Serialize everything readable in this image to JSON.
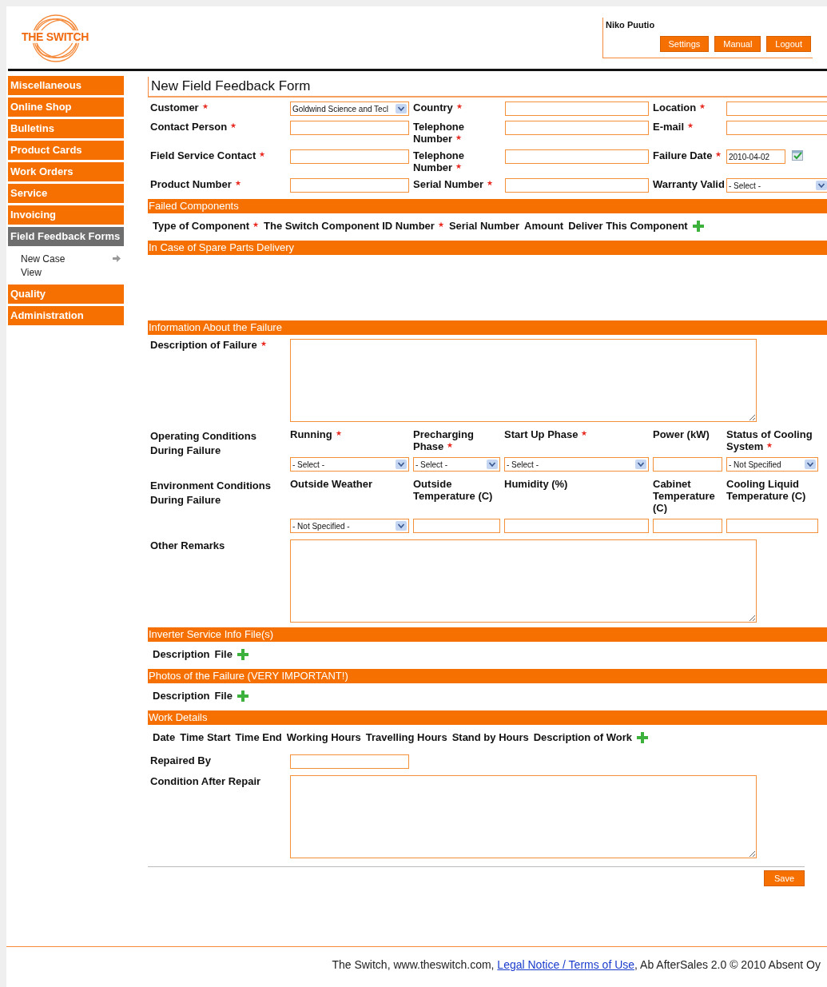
{
  "header": {
    "logo_text": "THE SWITCH",
    "user": "Niko Puutio",
    "buttons": [
      "Settings",
      "Manual",
      "Logout"
    ]
  },
  "sidebar": {
    "items": [
      {
        "label": "Miscellaneous",
        "selected": false
      },
      {
        "label": "Online Shop",
        "selected": false
      },
      {
        "label": "Bulletins",
        "selected": false
      },
      {
        "label": "Product Cards",
        "selected": false
      },
      {
        "label": "Work Orders",
        "selected": false
      },
      {
        "label": "Service",
        "selected": false
      },
      {
        "label": "Invoicing",
        "selected": false
      },
      {
        "label": "Field Feedback Forms",
        "selected": true,
        "children": [
          {
            "label": "New Case",
            "current": true
          },
          {
            "label": "View",
            "current": false
          }
        ]
      },
      {
        "label": "Quality",
        "selected": false
      },
      {
        "label": "Administration",
        "selected": false
      }
    ]
  },
  "form": {
    "title": "New Field Feedback Form",
    "rows": [
      [
        {
          "label": "Customer",
          "required": true,
          "kind": "select",
          "value": "Goldwind Science and Tecl"
        },
        {
          "label": "Country",
          "required": true,
          "kind": "text"
        },
        {
          "label": "Location",
          "required": true,
          "kind": "text"
        }
      ],
      [
        {
          "label": "Contact Person",
          "required": true,
          "kind": "text"
        },
        {
          "label": "Telephone Number",
          "required": true,
          "kind": "text"
        },
        {
          "label": "E-mail",
          "required": true,
          "kind": "text"
        }
      ],
      [
        {
          "label": "Field Service Contact",
          "required": true,
          "kind": "text"
        },
        {
          "label": "Telephone Number",
          "required": true,
          "kind": "text"
        },
        {
          "label": "Failure Date",
          "required": true,
          "kind": "date",
          "value": "2010-04-02"
        }
      ],
      [
        {
          "label": "Product Number",
          "required": true,
          "kind": "text"
        },
        {
          "label": "Serial Number",
          "required": true,
          "kind": "text"
        },
        {
          "label": "Warranty Valid",
          "required": false,
          "kind": "select",
          "value": "- Select -"
        }
      ]
    ]
  },
  "sections": [
    {
      "title": "Failed Components",
      "columns": [
        {
          "label": "Type of Component",
          "required": true
        },
        {
          "label": "The Switch Component ID Number",
          "required": true
        },
        {
          "label": "Serial Number",
          "required": false
        },
        {
          "label": "Amount",
          "required": false
        },
        {
          "label": "Deliver This Component",
          "required": false
        }
      ],
      "add": true
    },
    {
      "title": "In Case of Spare Parts Delivery"
    },
    {
      "title": "Information About the Failure",
      "rows": [
        {
          "kind": "textarea",
          "label": "Description of Failure",
          "required": true
        },
        {
          "kind": "conditions",
          "label": "Operating Conditions During Failure",
          "fields": [
            {
              "label": "Running",
              "required": true,
              "kind": "select",
              "value": "- Select -"
            },
            {
              "label": "Precharging Phase",
              "required": true,
              "kind": "select",
              "value": "- Select -"
            },
            {
              "label": "Start Up Phase",
              "required": true,
              "kind": "select",
              "value": "- Select -"
            },
            {
              "label": "Power (kW)",
              "required": false,
              "kind": "text"
            },
            {
              "label": "Status of Cooling System",
              "required": true,
              "kind": "select",
              "value": "- Not Specified"
            }
          ]
        },
        {
          "kind": "conditions",
          "label": "Environment Conditions During Failure",
          "fields": [
            {
              "label": "Outside Weather",
              "required": false,
              "kind": "select",
              "value": "- Not Specified -"
            },
            {
              "label": "Outside Temperature (C)",
              "required": false,
              "kind": "text"
            },
            {
              "label": "Humidity (%)",
              "required": false,
              "kind": "text"
            },
            {
              "label": "Cabinet Temperature (C)",
              "required": false,
              "kind": "text"
            },
            {
              "label": "Cooling Liquid Temperature (C)",
              "required": false,
              "kind": "text"
            }
          ]
        },
        {
          "kind": "textarea",
          "label": "Other Remarks",
          "required": false
        }
      ]
    },
    {
      "title": "Inverter Service Info File(s)",
      "columns": [
        {
          "label": "Description",
          "required": false
        },
        {
          "label": "File",
          "required": false
        }
      ],
      "add": true
    },
    {
      "title": "Photos of the Failure (VERY IMPORTANT!)",
      "columns": [
        {
          "label": "Description",
          "required": false
        },
        {
          "label": "File",
          "required": false
        }
      ],
      "add": true
    },
    {
      "title": "Work Details",
      "columns": [
        {
          "label": "Date",
          "required": false
        },
        {
          "label": "Time Start",
          "required": false
        },
        {
          "label": "Time End",
          "required": false
        },
        {
          "label": "Working Hours",
          "required": false
        },
        {
          "label": "Travelling Hours",
          "required": false
        },
        {
          "label": "Stand by Hours",
          "required": false
        },
        {
          "label": "Description of Work",
          "required": false
        }
      ],
      "add": true,
      "rows": [
        {
          "kind": "text",
          "label": "Repaired By",
          "required": false
        },
        {
          "kind": "textarea",
          "label": "Condition After Repair",
          "required": false
        }
      ]
    }
  ],
  "save_button": "Save",
  "footer": {
    "text_before": "The Switch, www.theswitch.com, ",
    "link": "Legal Notice / Terms of Use",
    "text_after": ", Ab AfterSales 2.0 © 2010 Absent Oy"
  }
}
